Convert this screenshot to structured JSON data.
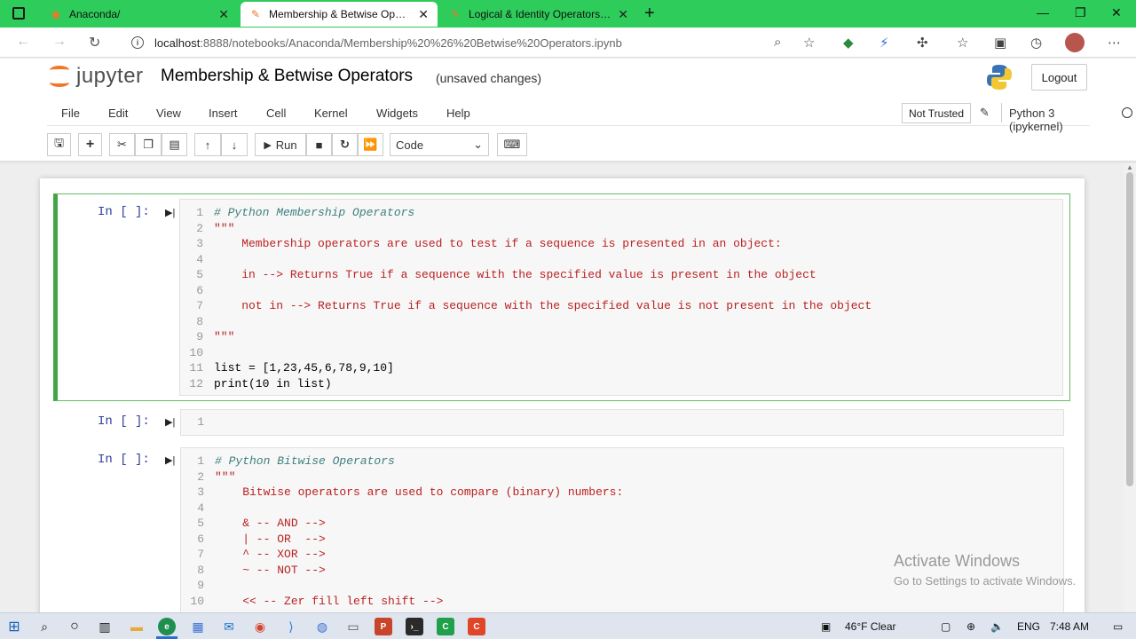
{
  "browser": {
    "tabs": [
      {
        "label": "Anaconda/",
        "active": false
      },
      {
        "label": "Membership & Betwise Operato",
        "active": true
      },
      {
        "label": "Logical & Identity Operators - N",
        "active": false
      }
    ],
    "url_host": "localhost",
    "url_path": ":8888/notebooks/Anaconda/Membership%20%26%20Betwise%20Operators.ipynb"
  },
  "jupyter": {
    "logo_text": "jupyter",
    "title": "Membership & Betwise Operators",
    "save_status": "(unsaved changes)",
    "logout_label": "Logout",
    "menu": [
      "File",
      "Edit",
      "View",
      "Insert",
      "Cell",
      "Kernel",
      "Widgets",
      "Help"
    ],
    "trust_label": "Not Trusted",
    "kernel_label": "Python 3 (ipykernel)",
    "toolbar": {
      "run_label": "Run",
      "cell_type": "Code"
    }
  },
  "cells": [
    {
      "prompt": "In [ ]:",
      "lines": [
        {
          "n": "1",
          "text": "# Python Membership Operators"
        },
        {
          "n": "2",
          "text": "\"\"\""
        },
        {
          "n": "3",
          "text": "    Membership operators are used to test if a sequence is presented in an object:"
        },
        {
          "n": "4",
          "text": ""
        },
        {
          "n": "5",
          "text": "    in --> Returns True if a sequence with the specified value is present in the object"
        },
        {
          "n": "6",
          "text": ""
        },
        {
          "n": "7",
          "text": "    not in --> Returns True if a sequence with the specified value is not present in the object"
        },
        {
          "n": "8",
          "text": ""
        },
        {
          "n": "9",
          "text": "\"\"\""
        },
        {
          "n": "10",
          "text": ""
        },
        {
          "n": "11",
          "text": "list = [1,23,45,6,78,9,10]"
        },
        {
          "n": "12",
          "text": "print(10 in list)"
        }
      ]
    },
    {
      "prompt": "In [ ]:",
      "lines": [
        {
          "n": "1",
          "text": ""
        }
      ]
    },
    {
      "prompt": "In [ ]:",
      "lines": [
        {
          "n": "1",
          "text": "# Python Bitwise Operators"
        },
        {
          "n": "2",
          "text": "\"\"\""
        },
        {
          "n": "3",
          "text": "    Bitwise operators are used to compare (binary) numbers:"
        },
        {
          "n": "4",
          "text": ""
        },
        {
          "n": "5",
          "text": "    & -- AND -->"
        },
        {
          "n": "6",
          "text": "    | -- OR  -->"
        },
        {
          "n": "7",
          "text": "    ^ -- XOR -->"
        },
        {
          "n": "8",
          "text": "    ~ -- NOT -->"
        },
        {
          "n": "9",
          "text": ""
        },
        {
          "n": "10",
          "text": "    << -- Zer fill left shift -->"
        }
      ]
    }
  ],
  "watermark": {
    "line1": "Activate Windows",
    "line2": "Go to Settings to activate Windows."
  },
  "taskbar": {
    "weather": "46°F  Clear",
    "lang": "ENG",
    "time": "7:48 AM"
  }
}
